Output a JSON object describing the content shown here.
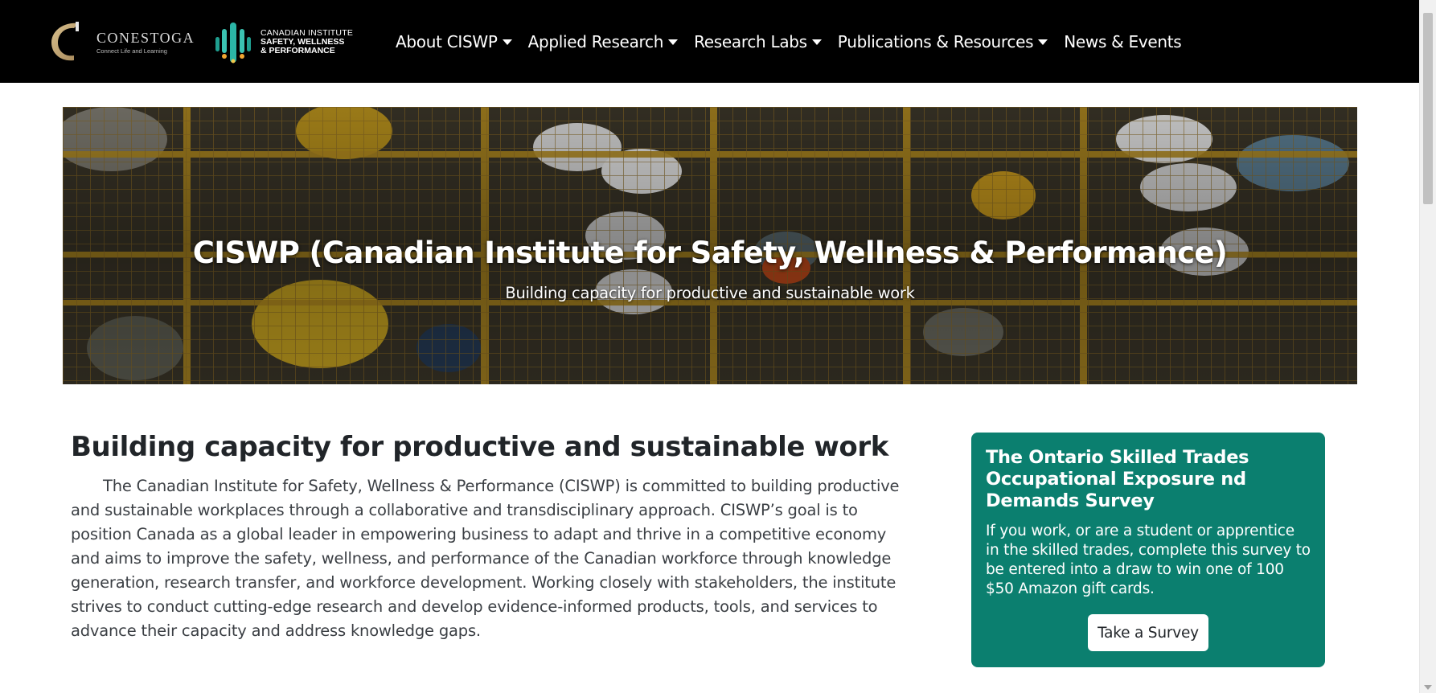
{
  "header": {
    "brand_conestoga": {
      "name": "CONESTOGA",
      "tagline": "Connect Life and Learning"
    },
    "brand_ciswp": {
      "line1": "CANADIAN INSTITUTE",
      "line2": "SAFETY, WELLNESS",
      "line3": "& PERFORMANCE"
    },
    "nav": [
      {
        "label": "About CISWP",
        "has_dropdown": true
      },
      {
        "label": "Applied Research",
        "has_dropdown": true
      },
      {
        "label": "Research Labs",
        "has_dropdown": true
      },
      {
        "label": "Publications & Resources",
        "has_dropdown": true
      },
      {
        "label": "News & Events",
        "has_dropdown": false
      }
    ]
  },
  "hero": {
    "title": "CISWP (Canadian Institute for Safety, Wellness & Performance)",
    "subtitle": "Building capacity for productive and sustainable work"
  },
  "main": {
    "heading": "Building capacity for productive and sustainable work",
    "body": "The Canadian Institute for Safety, Wellness & Performance (CISWP) is committed to building productive and sustainable workplaces through a collaborative and transdisciplinary approach. CISWP’s goal is to position Canada as a global leader in empowering business to adapt and thrive in a competitive economy and aims to improve the safety, wellness, and performance of the Canadian workforce through knowledge generation, research transfer, and workforce development. Working closely with stakeholders, the institute strives to conduct cutting-edge research and develop evidence-informed products, tools, and services to advance their capacity and address knowledge gaps."
  },
  "survey": {
    "title": "The Ontario Skilled Trades Occupational Exposure nd Demands Survey",
    "text": "If you work, or are a student or apprentice in the skilled trades, complete this survey to be entered into a draw to win one of 100 $50 Amazon gift cards.",
    "button_label": "Take a Survey"
  },
  "colors": {
    "nav_bg": "#000000",
    "survey_bg": "#0b7f6f",
    "text": "#212529"
  }
}
